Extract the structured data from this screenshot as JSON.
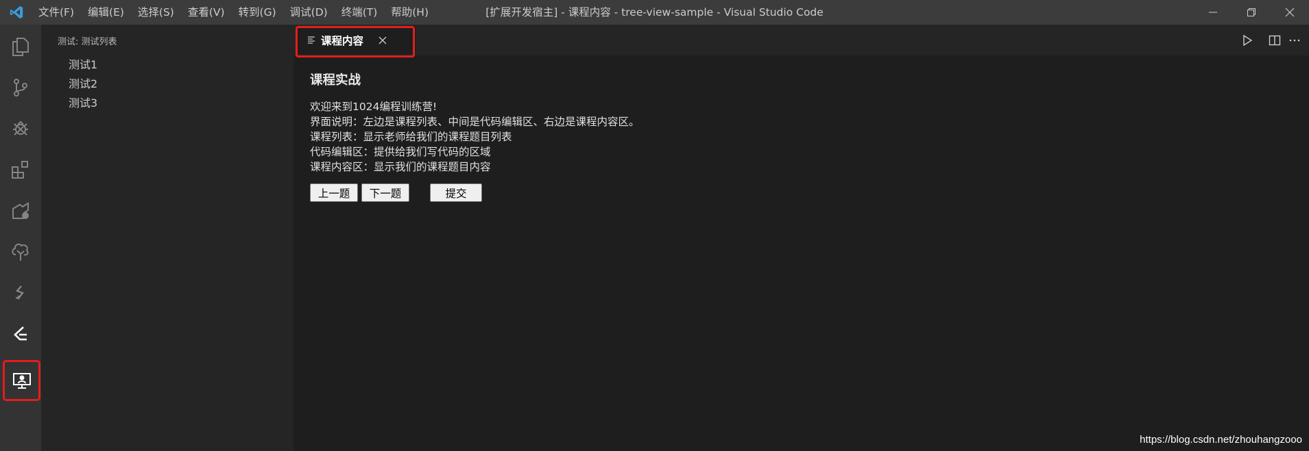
{
  "window": {
    "title": "[扩展开发宿主] - 课程内容 - tree-view-sample - Visual Studio Code"
  },
  "menu": [
    "文件(F)",
    "编辑(E)",
    "选择(S)",
    "查看(V)",
    "转到(G)",
    "调试(D)",
    "终端(T)",
    "帮助(H)"
  ],
  "activity_bar": {
    "icons": [
      "explorer-icon",
      "source-control-icon",
      "debug-icon",
      "extensions-icon",
      "remote-icon",
      "tree-icon",
      "test-icon",
      "leetcode-icon",
      "course-icon"
    ],
    "highlight_color": "#e51d1d"
  },
  "sidebar": {
    "title": "测试: 测试列表",
    "items": [
      "测试1",
      "测试2",
      "测试3"
    ]
  },
  "tab": {
    "label": "课程内容"
  },
  "content": {
    "heading": "课程实战",
    "paragraphs": [
      "欢迎来到1024编程训练营!",
      "界面说明：左边是课程列表、中间是代码编辑区、右边是课程内容区。",
      "课程列表：显示老师给我们的课程题目列表",
      "代码编辑区：提供给我们写代码的区域",
      "课程内容区：显示我们的课程题目内容"
    ],
    "buttons": {
      "prev": "上一题",
      "next": "下一题",
      "submit": "提交"
    }
  },
  "watermark": "https://blog.csdn.net/zhouhangzooo"
}
